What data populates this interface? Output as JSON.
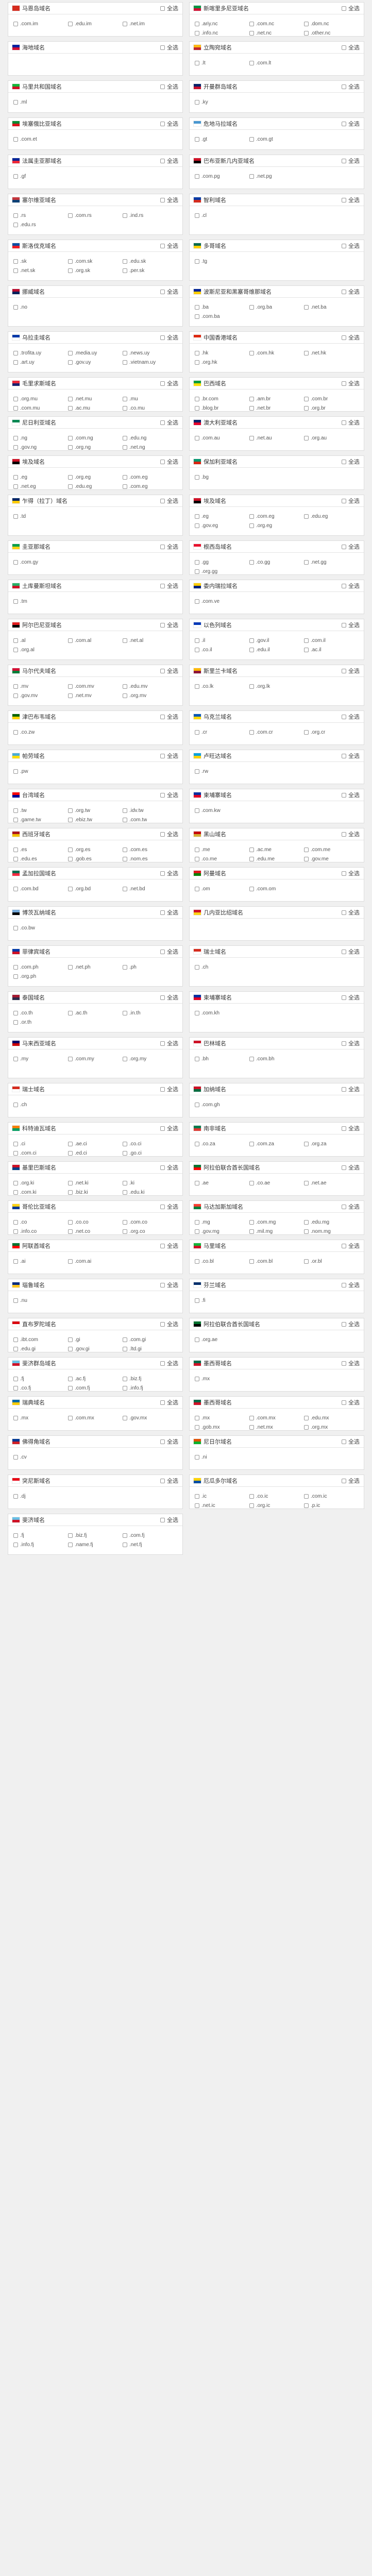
{
  "select_all_label": "全选",
  "regions": [
    {
      "name": "马恩岛域名",
      "flag": [
        "#d52b1e",
        "#d52b1e"
      ],
      "domains": [
        ".com.im",
        ".edu.im",
        ".net.im"
      ],
      "h": 67
    },
    {
      "name": "新喀里多尼亚域名",
      "flag": [
        "#009543",
        "#d21034"
      ],
      "domains": [
        ".ariy.nc",
        ".com.nc",
        ".dom.nc",
        ".info.nc",
        ".net.nc",
        ".other.nc"
      ],
      "h": 67
    },
    {
      "name": "海地域名",
      "flag": [
        "#00209f",
        "#d21034"
      ],
      "domains": [],
      "h": 67
    },
    {
      "name": "立陶宛域名",
      "flag": [
        "#fdb913",
        "#c1272d"
      ],
      "domains": [
        ".lt",
        ".com.lt"
      ],
      "h": 67
    },
    {
      "name": "马里共和国域名",
      "flag": [
        "#14b53a",
        "#ce1126"
      ],
      "domains": [
        ".ml"
      ],
      "h": 63
    },
    {
      "name": "开曼群岛域名",
      "flag": [
        "#012169",
        "#c8102e"
      ],
      "domains": [
        ".ky"
      ],
      "h": 63
    },
    {
      "name": "埃塞俄比亚域名",
      "flag": [
        "#078930",
        "#da121a"
      ],
      "domains": [
        ".com.et"
      ],
      "h": 63
    },
    {
      "name": "危地马拉域名",
      "flag": [
        "#4997d0",
        "#ffffff"
      ],
      "domains": [
        ".gt",
        ".com.gt"
      ],
      "h": 63
    },
    {
      "name": "法属圭亚那域名",
      "flag": [
        "#002395",
        "#ed2939"
      ],
      "domains": [
        ".gf"
      ],
      "h": 67
    },
    {
      "name": "巴布亚新几内亚域名",
      "flag": [
        "#ce1126",
        "#000000"
      ],
      "domains": [
        ".com.pg",
        ".net.pg"
      ],
      "h": 67
    },
    {
      "name": "塞尔维亚域名",
      "flag": [
        "#c6363c",
        "#0c4076"
      ],
      "domains": [
        ".rs",
        ".com.rs",
        ".ind.rs",
        ".edu.rs"
      ],
      "h": 80
    },
    {
      "name": "智利域名",
      "flag": [
        "#0039a6",
        "#d52b1e"
      ],
      "domains": [
        ".cl"
      ],
      "h": 80
    },
    {
      "name": "斯洛伐克域名",
      "flag": [
        "#0b4ea2",
        "#ee1c25"
      ],
      "domains": [
        ".sk",
        ".com.sk",
        ".edu.sk",
        ".net.sk",
        ".org.sk",
        ".per.sk"
      ],
      "h": 80
    },
    {
      "name": "多哥域名",
      "flag": [
        "#006a4e",
        "#ffce00"
      ],
      "domains": [
        ".tg"
      ],
      "h": 80
    },
    {
      "name": "挪威域名",
      "flag": [
        "#ba0c2f",
        "#00205b"
      ],
      "domains": [
        ".no"
      ],
      "h": 80
    },
    {
      "name": "波斯尼亚和黑塞哥维那域名",
      "flag": [
        "#002395",
        "#fecb00"
      ],
      "domains": [
        ".ba",
        ".org.ba",
        ".net.ba",
        ".com.ba"
      ],
      "h": 80
    },
    {
      "name": "乌拉圭域名",
      "flag": [
        "#0038a8",
        "#ffffff"
      ],
      "domains": [
        ".trofita.uy",
        ".media.uy",
        ".news.uy",
        ".art.uy",
        ".gov.uy",
        ".vietnam.uy"
      ],
      "h": 80
    },
    {
      "name": "中国香港域名",
      "flag": [
        "#de2910",
        "#ffffff"
      ],
      "domains": [
        ".hk",
        ".com.hk",
        ".net.hk",
        ".org.hk"
      ],
      "h": 80
    },
    {
      "name": "毛里求斯域名",
      "flag": [
        "#ea2839",
        "#1a206d"
      ],
      "domains": [
        ".org.mu",
        ".net.mu",
        ".mu",
        ".com.mu",
        ".ac.mu",
        ".co.mu"
      ],
      "h": 67
    },
    {
      "name": "巴西域名",
      "flag": [
        "#009c3b",
        "#ffdf00"
      ],
      "domains": [
        ".br.com",
        ".am.br",
        ".com.br",
        ".blog.br",
        ".net.br",
        ".org.br"
      ],
      "h": 67
    },
    {
      "name": "尼日利亚域名",
      "flag": [
        "#008751",
        "#ffffff"
      ],
      "domains": [
        ".ng",
        ".com.ng",
        ".edu.ng",
        ".gov.ng",
        ".org.ng",
        ".net.ng"
      ],
      "h": 67
    },
    {
      "name": "澳大利亚域名",
      "flag": [
        "#012169",
        "#e4002b"
      ],
      "domains": [
        ".com.au",
        ".net.au",
        ".org.au"
      ],
      "h": 67
    },
    {
      "name": "埃及域名",
      "flag": [
        "#ce1126",
        "#000000"
      ],
      "domains": [
        ".eg",
        ".org.eg",
        ".com.eg",
        ".net.eg",
        ".edu.eg",
        ".com.eg"
      ],
      "h": 67
    },
    {
      "name": "保加利亚域名",
      "flag": [
        "#00966e",
        "#d62612"
      ],
      "domains": [
        ".bg"
      ],
      "h": 67
    },
    {
      "name": "乍得（拉丁）域名",
      "flag": [
        "#002664",
        "#fecb00"
      ],
      "domains": [
        ".td"
      ],
      "h": 80
    },
    {
      "name": "埃及域名",
      "flag": [
        "#ce1126",
        "#000000"
      ],
      "domains": [
        ".eg",
        ".com.eg",
        ".edu.eg",
        ".gov.eg",
        ".org.eg"
      ],
      "h": 80
    },
    {
      "name": "圭亚那域名",
      "flag": [
        "#009e49",
        "#fcd116"
      ],
      "domains": [
        ".com.gy"
      ],
      "h": 67
    },
    {
      "name": "根西岛域名",
      "flag": [
        "#e8112d",
        "#ffffff"
      ],
      "domains": [
        ".gg",
        ".co.gg",
        ".net.gg",
        ".org.gg"
      ],
      "h": 67
    },
    {
      "name": "土库曼斯坦域名",
      "flag": [
        "#28ae66",
        "#ce1126"
      ],
      "domains": [
        ".tm"
      ],
      "h": 67
    },
    {
      "name": "委内瑞拉域名",
      "flag": [
        "#ffcc00",
        "#00247d"
      ],
      "domains": [
        ".com.ve"
      ],
      "h": 67
    },
    {
      "name": "阿尔巴尼亚域名",
      "flag": [
        "#e41e20",
        "#000000"
      ],
      "domains": [
        ".al",
        ".com.al",
        ".net.al",
        ".org.al"
      ],
      "h": 80
    },
    {
      "name": "以色列域名",
      "flag": [
        "#0038b8",
        "#ffffff"
      ],
      "domains": [
        ".il",
        ".gov.il",
        ".com.il",
        ".co.il",
        ".edu.il",
        ".ac.il"
      ],
      "h": 80
    },
    {
      "name": "马尔代夫域名",
      "flag": [
        "#d21034",
        "#007e3a"
      ],
      "domains": [
        ".mv",
        ".com.mv",
        ".edu.mv",
        ".gov.mv",
        ".net.mv",
        ".org.mv"
      ],
      "h": 80
    },
    {
      "name": "斯里兰卡域名",
      "flag": [
        "#ffb700",
        "#8d153a"
      ],
      "domains": [
        ".co.lk",
        ".org.lk"
      ],
      "h": 80
    },
    {
      "name": "津巴布韦域名",
      "flag": [
        "#006400",
        "#ffd200"
      ],
      "domains": [
        ".co.zw"
      ],
      "h": 67
    },
    {
      "name": "乌克兰域名",
      "flag": [
        "#0057b7",
        "#ffd700"
      ],
      "domains": [
        ".cr",
        ".com.cr",
        ".org.cr"
      ],
      "h": 67
    },
    {
      "name": "帕劳域名",
      "flag": [
        "#4aadd6",
        "#ffde00"
      ],
      "domains": [
        ".pw"
      ],
      "h": 67
    },
    {
      "name": "卢旺达域名",
      "flag": [
        "#00a1de",
        "#fad201"
      ],
      "domains": [
        ".rw"
      ],
      "h": 67
    },
    {
      "name": "台湾域名",
      "flag": [
        "#fe0000",
        "#000095"
      ],
      "domains": [
        ".tw",
        ".org.tw",
        ".idv.tw",
        ".game.tw",
        ".ebiz.tw",
        ".com.tw"
      ],
      "h": 67
    },
    {
      "name": "柬埔寨域名",
      "flag": [
        "#032ea1",
        "#e00025"
      ],
      "domains": [
        ".com.kw"
      ],
      "h": 67
    },
    {
      "name": "西班牙域名",
      "flag": [
        "#aa151b",
        "#f1bf00"
      ],
      "domains": [
        ".es",
        ".org.es",
        ".com.es",
        ".edu.es",
        ".gob.es",
        ".nom.es"
      ],
      "h": 67
    },
    {
      "name": "黑山域名",
      "flag": [
        "#c40308",
        "#d4af37"
      ],
      "domains": [
        ".me",
        ".ac.me",
        ".com.me",
        ".co.me",
        ".edu.me",
        ".gov.me"
      ],
      "h": 67
    },
    {
      "name": "孟加拉国域名",
      "flag": [
        "#006a4e",
        "#f42a41"
      ],
      "domains": [
        ".com.bd",
        ".org.bd",
        ".net.bd"
      ],
      "h": 67
    },
    {
      "name": "阿曼域名",
      "flag": [
        "#db161b",
        "#008000"
      ],
      "domains": [
        ".om",
        ".com.om"
      ],
      "h": 67
    },
    {
      "name": "博茨瓦纳域名",
      "flag": [
        "#75aadb",
        "#000000"
      ],
      "domains": [
        ".co.bw"
      ],
      "h": 67
    },
    {
      "name": "几内亚比绍域名",
      "flag": [
        "#ce1126",
        "#fcd116"
      ],
      "domains": [],
      "h": 67
    },
    {
      "name": "菲律宾域名",
      "flag": [
        "#0038a8",
        "#ce1126"
      ],
      "domains": [
        ".com.ph",
        ".net.ph",
        ".ph",
        ".org.ph"
      ],
      "h": 80
    },
    {
      "name": "瑞士域名",
      "flag": [
        "#d52b1e",
        "#ffffff"
      ],
      "domains": [
        ".ch"
      ],
      "h": 80
    },
    {
      "name": "泰国域名",
      "flag": [
        "#a51931",
        "#2d2a4a"
      ],
      "domains": [
        ".co.th",
        ".ac.th",
        ".in.th",
        ".or.th"
      ],
      "h": 80
    },
    {
      "name": "柬埔寨域名",
      "flag": [
        "#032ea1",
        "#e00025"
      ],
      "domains": [
        ".com.kh"
      ],
      "h": 80
    },
    {
      "name": "马来西亚域名",
      "flag": [
        "#010066",
        "#cc0001"
      ],
      "domains": [
        ".my",
        ".com.my",
        ".org.my"
      ],
      "h": 80
    },
    {
      "name": "巴林域名",
      "flag": [
        "#ce1126",
        "#ffffff"
      ],
      "domains": [
        ".bh",
        ".com.bh"
      ],
      "h": 80
    },
    {
      "name": "瑞士域名",
      "flag": [
        "#d52b1e",
        "#ffffff"
      ],
      "domains": [
        ".ch"
      ],
      "h": 67
    },
    {
      "name": "加纳域名",
      "flag": [
        "#ce1126",
        "#006b3f"
      ],
      "domains": [
        ".com.gh"
      ],
      "h": 67
    },
    {
      "name": "科特迪瓦域名",
      "flag": [
        "#f77f00",
        "#009e60"
      ],
      "domains": [
        ".ci",
        ".ae.ci",
        ".co.ci",
        ".com.ci",
        ".ed.ci",
        ".go.ci"
      ],
      "h": 67
    },
    {
      "name": "南非域名",
      "flag": [
        "#007a4d",
        "#de3831"
      ],
      "domains": [
        ".co.za",
        ".com.za",
        ".org.za"
      ],
      "h": 67
    },
    {
      "name": "基里巴斯域名",
      "flag": [
        "#ce1126",
        "#003f87"
      ],
      "domains": [
        ".org.ki",
        ".net.ki",
        ".ki",
        ".com.ki",
        ".biz.ki",
        ".edu.ki"
      ],
      "h": 67
    },
    {
      "name": "阿拉伯联合酋长国域名",
      "flag": [
        "#00732f",
        "#ff0000"
      ],
      "domains": [
        ".ae",
        ".co.ae",
        ".net.ae"
      ],
      "h": 67
    },
    {
      "name": "哥伦比亚域名",
      "flag": [
        "#fcd116",
        "#003893"
      ],
      "domains": [
        ".co",
        ".co.co",
        ".com.co",
        ".info.co",
        ".net.co",
        ".org.co"
      ],
      "h": 67
    },
    {
      "name": "马达加斯加域名",
      "flag": [
        "#fc3d32",
        "#007e3a"
      ],
      "domains": [
        ".mg",
        ".com.mg",
        ".edu.mg",
        ".gov.mg",
        ".mil.mg",
        ".nom.mg"
      ],
      "h": 67
    },
    {
      "name": "阿联酋域名",
      "flag": [
        "#00732f",
        "#ff0000"
      ],
      "domains": [
        ".ai",
        ".com.ai"
      ],
      "h": 67
    },
    {
      "name": "马里域名",
      "flag": [
        "#14b53a",
        "#ce1126"
      ],
      "domains": [
        ".co.bl",
        ".com.bl",
        ".or.bl"
      ],
      "h": 67
    },
    {
      "name": "瑙鲁域名",
      "flag": [
        "#002b7f",
        "#ffc61e"
      ],
      "domains": [
        ".nu"
      ],
      "h": 67
    },
    {
      "name": "芬兰域名",
      "flag": [
        "#002f6c",
        "#ffffff"
      ],
      "domains": [
        ".fi"
      ],
      "h": 67
    },
    {
      "name": "直布罗陀域名",
      "flag": [
        "#da000c",
        "#ffffff"
      ],
      "domains": [
        ".ibt.com",
        ".gi",
        ".com.gi",
        ".edu.gi",
        ".gov.gi",
        ".ltd.gi"
      ],
      "h": 67
    },
    {
      "name": "阿拉伯联合酋长国域名",
      "flag": [
        "#00732f",
        "#000000"
      ],
      "domains": [
        ".org.ae"
      ],
      "h": 67
    },
    {
      "name": "斐济群岛域名",
      "flag": [
        "#68bfe5",
        "#ce1126"
      ],
      "domains": [
        ".fj",
        ".ac.fj",
        ".biz.fj",
        ".co.fj",
        ".com.fj",
        ".info.fj"
      ],
      "h": 67
    },
    {
      "name": "墨西哥域名",
      "flag": [
        "#006847",
        "#ce1126"
      ],
      "domains": [
        ".mx"
      ],
      "h": 67
    },
    {
      "name": "瑞典域名",
      "flag": [
        "#006aa7",
        "#fecc00"
      ],
      "domains": [
        ".mx",
        ".com.mx",
        ".gov.mx"
      ],
      "h": 67
    },
    {
      "name": "墨西哥域名",
      "flag": [
        "#006847",
        "#ce1126"
      ],
      "domains": [
        ".mx",
        ".com.mx",
        ".edu.mx",
        ".gob.mx",
        ".net.mx",
        ".org.mx"
      ],
      "h": 67
    },
    {
      "name": "佛得角域名",
      "flag": [
        "#003893",
        "#cf2027"
      ],
      "domains": [
        ".cv"
      ],
      "h": 67
    },
    {
      "name": "尼日尔域名",
      "flag": [
        "#e05206",
        "#0db02b"
      ],
      "domains": [
        ".ni"
      ],
      "h": 67
    },
    {
      "name": "突尼斯域名",
      "flag": [
        "#e70013",
        "#ffffff"
      ],
      "domains": [
        ".dj"
      ],
      "h": 67
    },
    {
      "name": "厄瓜多尔域名",
      "flag": [
        "#ffd100",
        "#034ea2"
      ],
      "domains": [
        ".ic",
        ".co.ic",
        ".com.ic",
        ".net.ic",
        ".org.ic",
        ".p.ic"
      ],
      "h": 67
    },
    {
      "name": "斐济域名",
      "flag": [
        "#68bfe5",
        "#ce1126"
      ],
      "domains": [
        ".fj",
        ".biz.fj",
        ".com.fj",
        ".info.fj",
        ".name.fj",
        ".net.fj"
      ],
      "h": 80
    }
  ]
}
